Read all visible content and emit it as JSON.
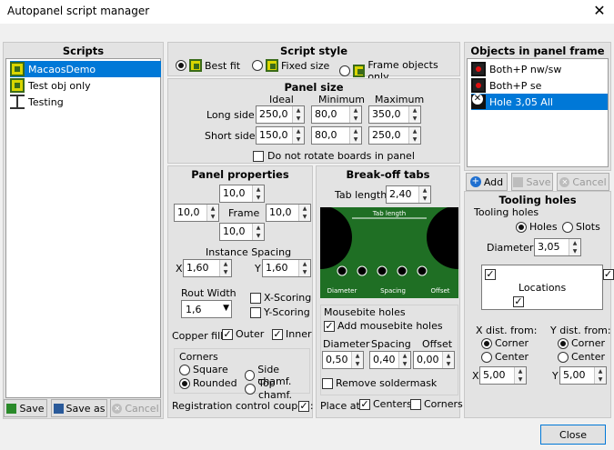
{
  "window": {
    "title": "Autopanel script manager",
    "close_glyph": "✕"
  },
  "scripts": {
    "header": "Scripts",
    "items": [
      {
        "label": "MacaosDemo",
        "icon": "board-icon",
        "selected": true
      },
      {
        "label": "Test obj only",
        "icon": "board-icon",
        "selected": false
      },
      {
        "label": "Testing",
        "icon": "dimension-icon",
        "selected": false
      }
    ],
    "save_label": "Save",
    "save_as_label": "Save as",
    "cancel_label": "Cancel"
  },
  "script_style": {
    "header": "Script style",
    "best_fit": "Best fit",
    "fixed_size": "Fixed size",
    "frame_objects_only": "Frame objects only",
    "selected": "best_fit"
  },
  "panel_size": {
    "header": "Panel size",
    "col_ideal": "Ideal",
    "col_min": "Minimum",
    "col_max": "Maximum",
    "long_label": "Long side",
    "long_ideal": "250,0",
    "long_min": "80,0",
    "long_max": "350,0",
    "short_label": "Short side",
    "short_ideal": "150,0",
    "short_min": "80,0",
    "short_max": "250,0",
    "no_rotate_label": "Do not rotate boards in panel"
  },
  "panel_props": {
    "header": "Panel properties",
    "frame_top": "10,0",
    "frame_left": "10,0",
    "frame_right": "10,0",
    "frame_bottom": "10,0",
    "frame_label": "Frame",
    "instance_spacing_label": "Instance Spacing",
    "x_label": "X",
    "x_val": "1,60",
    "y_label": "Y",
    "y_val": "1,60",
    "rout_width_label": "Rout Width",
    "rout_width": "1,6",
    "x_scoring": "X-Scoring",
    "y_scoring": "Y-Scoring",
    "copper_fill_label": "Copper fill:",
    "outer_label": "Outer",
    "inner_label": "Inner",
    "corners_label": "Corners",
    "square": "Square",
    "side_chamf": "Side chamf.",
    "rounded": "Rounded",
    "top_chamf": "Top chamf.",
    "reg_coupon_label": "Registration control coupon:"
  },
  "breakoff": {
    "header": "Break-off tabs",
    "tab_length_label": "Tab length",
    "tab_length": "2,40",
    "diagram": {
      "tab_length": "Tab length",
      "diameter": "Diameter",
      "spacing": "Spacing",
      "offset": "Offset"
    },
    "mousebite_label": "Mousebite holes",
    "add_mousebite": "Add mousebite holes",
    "diameter_label": "Diameter",
    "spacing_label": "Spacing",
    "offset_label": "Offset",
    "diameter": "0,50",
    "spacing": "0,40",
    "offset": "0,00",
    "remove_soldermask": "Remove soldermask",
    "place_at": "Place at",
    "centers": "Centers",
    "corners": "Corners"
  },
  "objects": {
    "header": "Objects in panel frame",
    "items": [
      {
        "label": "Both+P nw/sw",
        "icon": "red-dot-icon",
        "selected": false
      },
      {
        "label": "Both+P se",
        "icon": "red-dot-icon",
        "selected": false
      },
      {
        "label": "Hole 3,05 All",
        "icon": "hole-icon",
        "selected": true
      }
    ],
    "add_label": "Add",
    "save_label": "Save",
    "cancel_label": "Cancel"
  },
  "tooling": {
    "header": "Tooling holes",
    "sub": "Tooling holes",
    "holes": "Holes",
    "slots": "Slots",
    "diameter_label": "Diameter:",
    "diameter": "3,05",
    "locations_label": "Locations",
    "x_dist_label": "X dist. from:",
    "y_dist_label": "Y dist. from:",
    "corner": "Corner",
    "center": "Center",
    "x_label": "X",
    "x_val": "5,00",
    "y_label": "Y",
    "y_val": "5,00"
  },
  "close_label": "Close"
}
